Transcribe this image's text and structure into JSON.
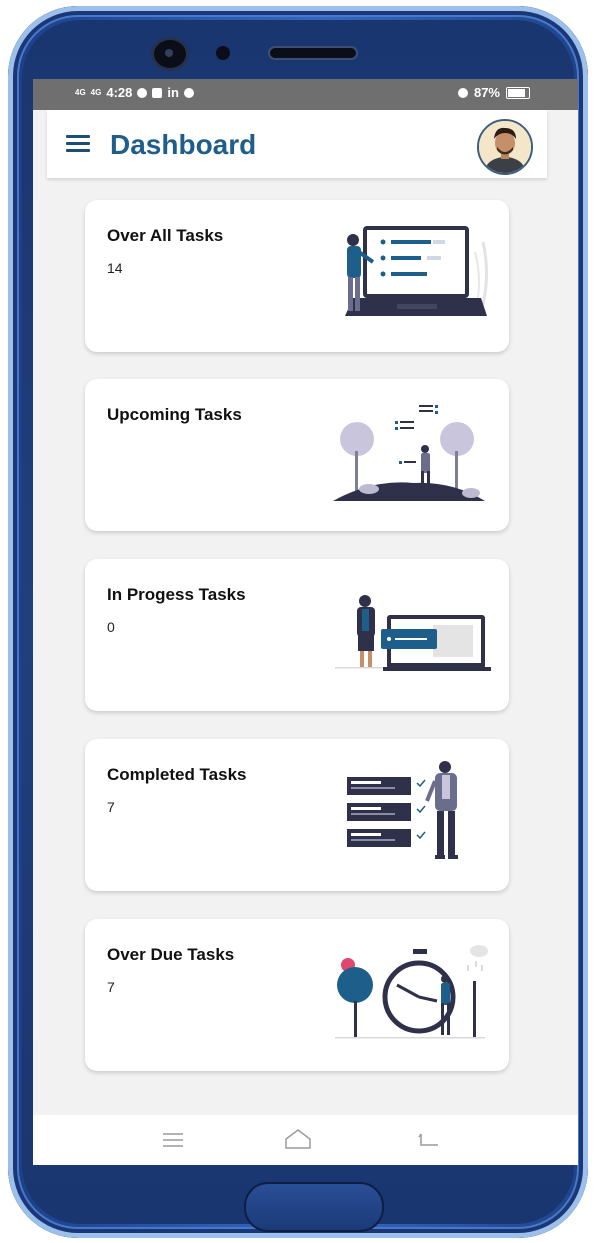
{
  "status_bar": {
    "time": "4:28",
    "signal_1": "4G",
    "signal_2": "4G",
    "social": "in",
    "battery": "87%"
  },
  "header": {
    "title": "Dashboard"
  },
  "cards": [
    {
      "title": "Over All Tasks",
      "count": "14"
    },
    {
      "title": "Upcoming Tasks",
      "count": ""
    },
    {
      "title": "In Progess Tasks",
      "count": "0"
    },
    {
      "title": "Completed Tasks",
      "count": "7"
    },
    {
      "title": "Over Due Tasks",
      "count": "7"
    }
  ],
  "icons": {
    "menu": "hamburger-menu-icon",
    "avatar": "user-avatar",
    "nav": [
      "recents-icon",
      "home-icon",
      "back-icon"
    ]
  },
  "colors": {
    "accent": "#1f5e8a",
    "illustration_primary": "#2f3049",
    "illustration_accent": "#1d5f8a",
    "status_bar": "#6f6f6f"
  }
}
